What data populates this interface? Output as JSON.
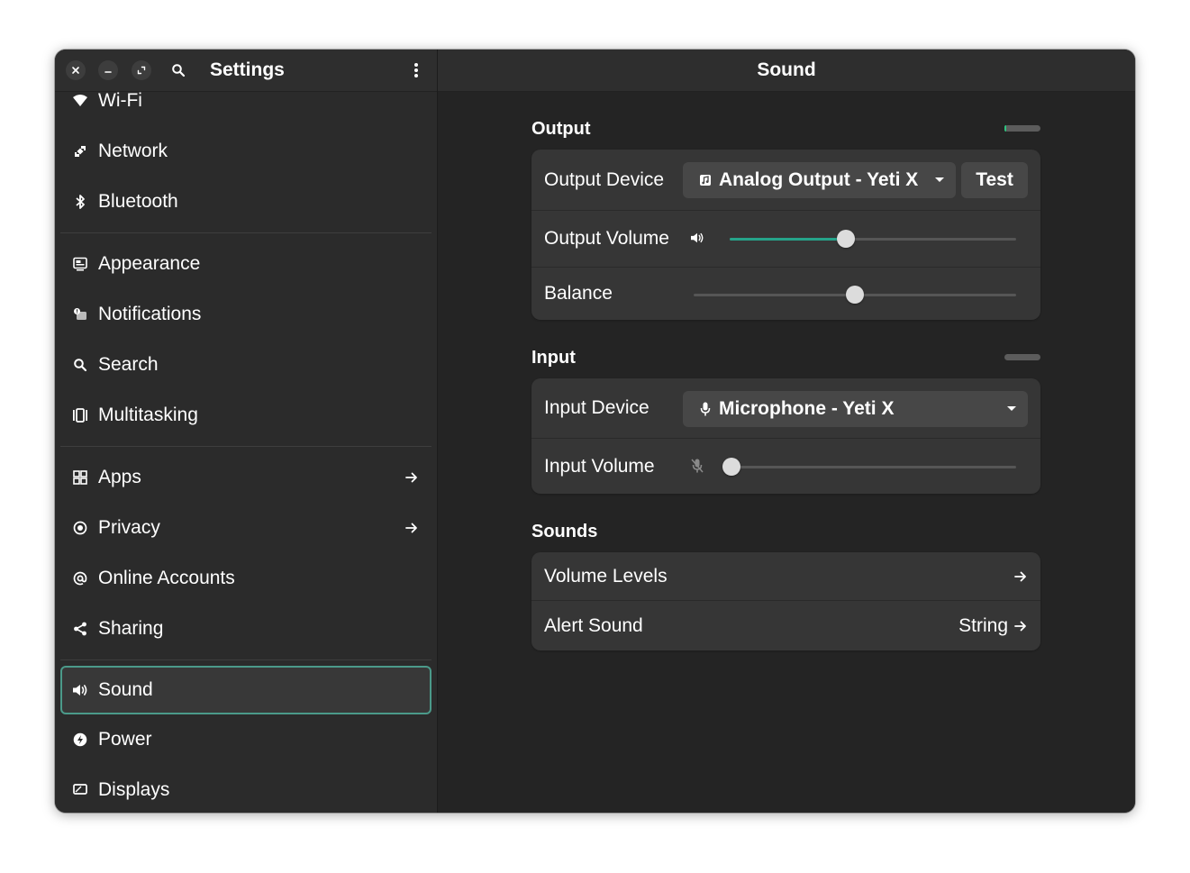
{
  "window": {
    "sidebar_title": "Settings",
    "content_title": "Sound"
  },
  "sidebar": {
    "items": [
      {
        "label": "Wi-Fi",
        "icon": "wifi-icon"
      },
      {
        "label": "Network",
        "icon": "network-icon"
      },
      {
        "label": "Bluetooth",
        "icon": "bluetooth-icon"
      },
      {
        "label": "Appearance",
        "icon": "appearance-icon"
      },
      {
        "label": "Notifications",
        "icon": "notifications-icon"
      },
      {
        "label": "Search",
        "icon": "search-icon"
      },
      {
        "label": "Multitasking",
        "icon": "multitasking-icon"
      },
      {
        "label": "Apps",
        "icon": "apps-icon",
        "arrow": true
      },
      {
        "label": "Privacy",
        "icon": "privacy-icon",
        "arrow": true
      },
      {
        "label": "Online Accounts",
        "icon": "online-accounts-icon"
      },
      {
        "label": "Sharing",
        "icon": "sharing-icon"
      },
      {
        "label": "Sound",
        "icon": "sound-icon",
        "active": true
      },
      {
        "label": "Power",
        "icon": "power-icon"
      },
      {
        "label": "Displays",
        "icon": "displays-icon"
      }
    ]
  },
  "output": {
    "section_title": "Output",
    "level": 0.05,
    "device_label": "Output Device",
    "device_value": "Analog Output - Yeti X",
    "test_label": "Test",
    "volume_label": "Output Volume",
    "volume_level": 0.4,
    "balance_label": "Balance",
    "balance_level": 0.5
  },
  "input": {
    "section_title": "Input",
    "level": 0.0,
    "device_label": "Input Device",
    "device_value": "Microphone - Yeti X",
    "volume_label": "Input Volume",
    "volume_level": 0.0
  },
  "sounds": {
    "section_title": "Sounds",
    "volume_levels_label": "Volume Levels",
    "alert_sound_label": "Alert Sound",
    "alert_sound_value": "String"
  },
  "colors": {
    "accent": "#26a48a",
    "active_border": "#4b9a8a",
    "window_bg": "#242424",
    "sidebar_bg": "#2b2b2b",
    "row_bg": "#363636"
  }
}
